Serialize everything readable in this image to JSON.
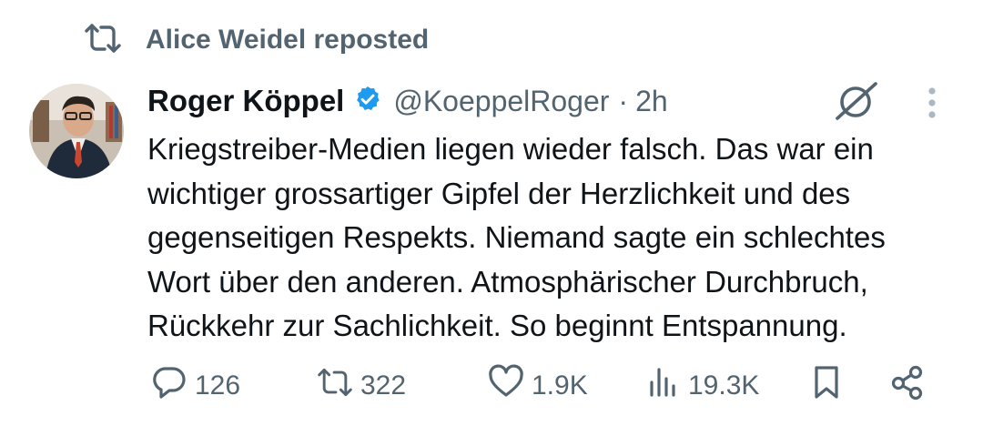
{
  "repost_banner": {
    "icon": "repost-icon",
    "label": "Alice Weidel reposted"
  },
  "tweet": {
    "author_name": "Roger Köppel",
    "verified": true,
    "handle": "@KoeppelRoger",
    "separator": "·",
    "time": "2h",
    "text": "Kriegstreiber-Medien liegen wieder falsch. Das war ein\nwichtiger grossartiger Gipfel der Herzlichkeit und des\ngegenseitigen Respekts. Niemand sagte ein schlechtes\nWort über den anderen. Atmosphärischer Durchbruch,\nRückkehr zur Sachlichkeit. So beginnt Entspannung."
  },
  "actions": {
    "replies": "126",
    "reposts": "322",
    "likes": "1.9K",
    "views": "19.3K"
  },
  "colors": {
    "text": "#0f1419",
    "secondary": "#536471",
    "verified_badge": "#1d9bf0",
    "background": "#ffffff"
  }
}
